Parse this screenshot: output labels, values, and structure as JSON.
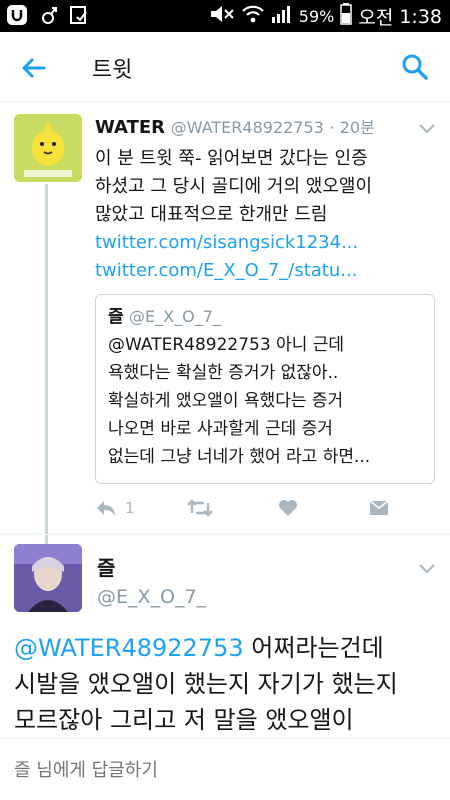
{
  "status_bar": {
    "battery_pct": "59%",
    "carrier_label": "오전",
    "time": "1:38",
    "icons": [
      "u-app-icon",
      "female-icon",
      "box-check-icon",
      "mute-icon",
      "wifi-icon",
      "signal-icon",
      "battery-icon"
    ]
  },
  "app_bar": {
    "title": "트윗",
    "back_icon": "arrow-left-icon",
    "search_icon": "search-icon"
  },
  "colors": {
    "accent": "#1da1f2",
    "secondary_text": "#8899a6",
    "thread_line": "#ccd6dd"
  },
  "tweet1": {
    "name": "WATER",
    "handle": "@WATER48922753",
    "time": "· 20분",
    "text_line1": "이 분 트윗 쭉- 읽어보면 갔다는 인증",
    "text_line2": "하셨고 그 당시 골디에 거의 앴오앨이",
    "text_line3": "많았고 대표적으로 한개만 드림",
    "link1": "twitter.com/sisangsick1234...",
    "link2": "twitter.com/E_X_O_7_/statu...",
    "quote": {
      "name": "즐",
      "handle": "@E_X_O_7_",
      "line1": "@WATER48922753 아니 근데",
      "line2": "욕했다는 확실한 증거가 없잖아..",
      "line3": "확실하게 앴오앨이 욕했다는 증거",
      "line4": "나오면 바로 사과할게 근데 증거",
      "line5": "없는데 그냥 너네가 했어 라고 하면..."
    },
    "reply_count": "1"
  },
  "tweet2": {
    "name": "즐",
    "handle": "@E_X_O_7_",
    "mention": "@WATER48922753",
    "text_rest1": " 어쩌라는건데",
    "text_line2": "시발을 앴오앨이 했는지 자기가 했는지",
    "text_line3": "모르잖아 그리고 저 말을 앴오앨이"
  },
  "reply_bar": {
    "placeholder": "즐 님에게 답글하기"
  }
}
